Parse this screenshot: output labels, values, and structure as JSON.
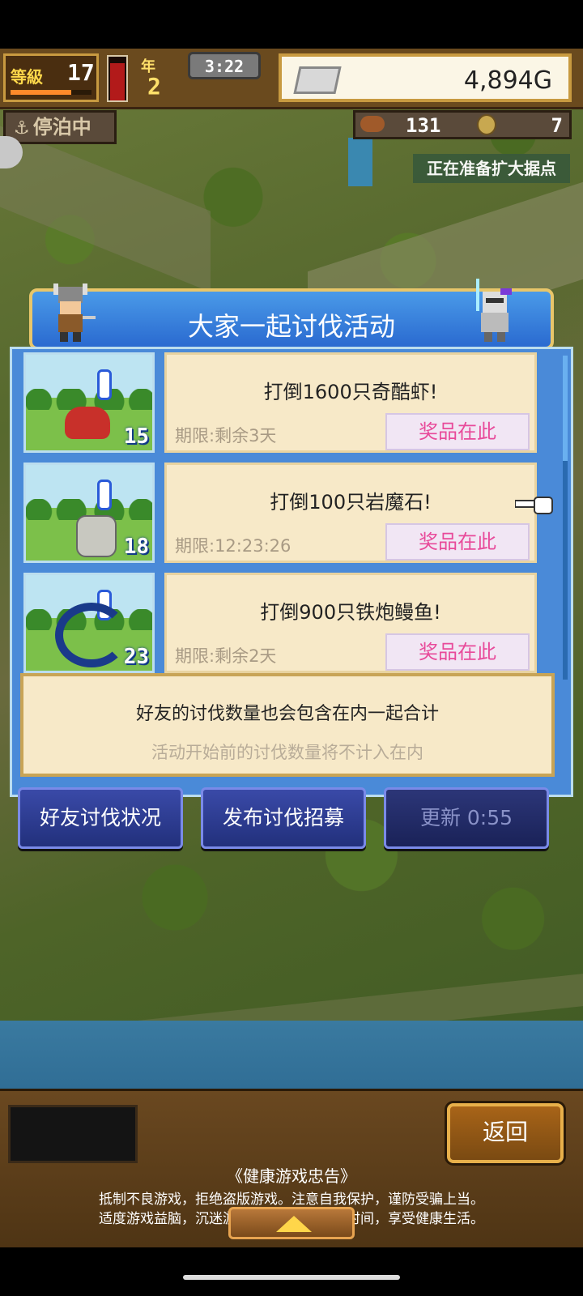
{
  "hud": {
    "level_label": "等級",
    "level": "17",
    "xp_fraction": 0.75,
    "stamina_fraction": 0.85,
    "year_label": "年",
    "year": "2",
    "clock": "3:22",
    "money": "4,894G",
    "status": "停泊中",
    "food": "131",
    "coins": "7",
    "notice": "正在准备扩大据点"
  },
  "dialog": {
    "title": "大家一起讨伐活动",
    "quests": [
      {
        "title": "打倒1600只奇酷虾!",
        "deadline": "期限:剩余3天",
        "reward": "奖品在此",
        "thumb_count": "15",
        "monster_icon": "crab-monster-icon"
      },
      {
        "title": "打倒100只岩魔石!",
        "deadline": "期限:12:23:26",
        "reward": "奖品在此",
        "thumb_count": "18",
        "monster_icon": "rock-monster-icon"
      },
      {
        "title": "打倒900只铁炮鳗鱼!",
        "deadline": "期限:剩余2天",
        "reward": "奖品在此",
        "thumb_count": "23",
        "monster_icon": "eel-monster-icon"
      }
    ],
    "info_main": "好友的讨伐数量也会包含在内一起合计",
    "info_sub": "活动开始前的讨伐数量将不计入在内"
  },
  "buttons": {
    "friend_status": "好友讨伐状况",
    "recruit": "发布讨伐招募",
    "refresh": "更新 0:55"
  },
  "bottom": {
    "back": "返回",
    "health_title": "《健康游戏忠告》",
    "health_line1": "抵制不良游戏，拒绝盗版游戏。注意自我保护，谨防受骗上当。",
    "health_line2": "适度游戏益脑，沉迷游戏伤身。合理安排时间，享受健康生活。"
  }
}
